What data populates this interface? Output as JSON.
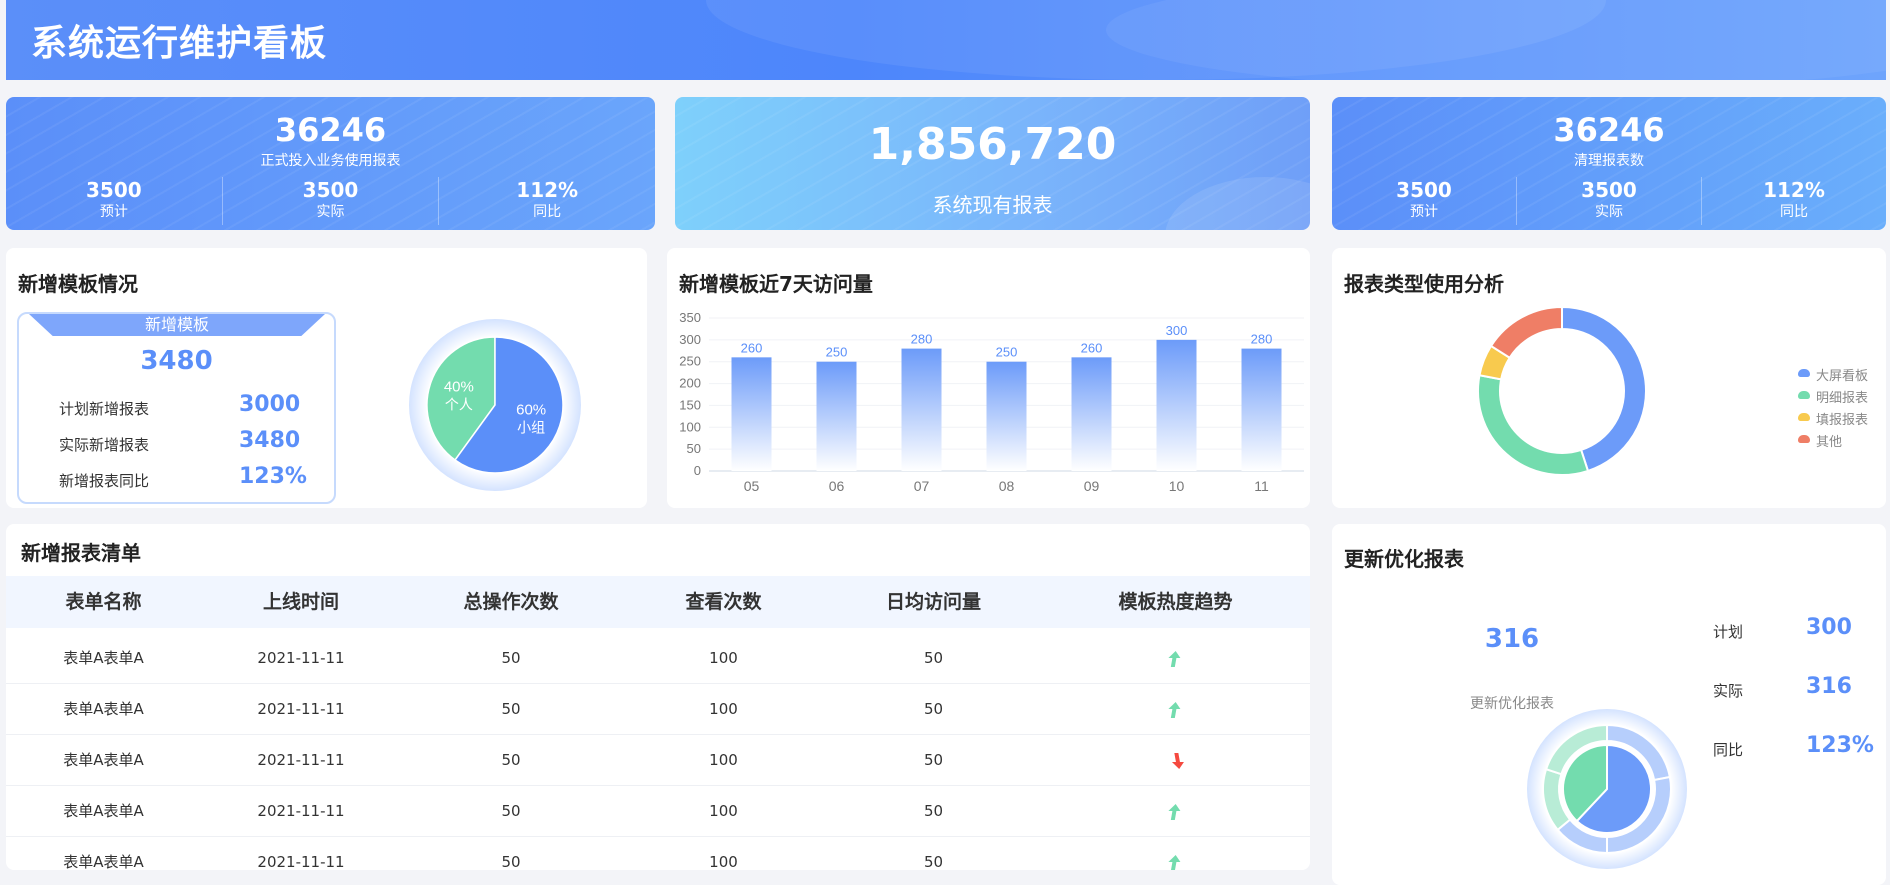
{
  "header": {
    "title": "系统运行维护看板"
  },
  "kpi_left": {
    "value": "36246",
    "label": "正式投入业务使用报表",
    "subs": [
      {
        "value": "3500",
        "label": "预计"
      },
      {
        "value": "3500",
        "label": "实际"
      },
      {
        "value": "112%",
        "label": "同比"
      }
    ]
  },
  "kpi_mid": {
    "value": "1,856,720",
    "label": "系统现有报表"
  },
  "kpi_right": {
    "value": "36246",
    "label": "清理报表数",
    "subs": [
      {
        "value": "3500",
        "label": "预计"
      },
      {
        "value": "3500",
        "label": "实际"
      },
      {
        "value": "112%",
        "label": "同比"
      }
    ]
  },
  "template_card": {
    "title": "新增模板情况",
    "tab_label": "新增模板",
    "total": "3480",
    "rows": [
      {
        "label": "计划新增报表",
        "value": "3000"
      },
      {
        "label": "实际新增报表",
        "value": "3480"
      },
      {
        "label": "新增报表同比",
        "value": "123%"
      }
    ]
  },
  "visits_card": {
    "title": "新增模板近7天访问量"
  },
  "types_card": {
    "title": "报表类型使用分析"
  },
  "list_card": {
    "title": "新增报表清单",
    "columns": [
      "表单名称",
      "上线时间",
      "总操作次数",
      "查看次数",
      "日均访问量",
      "模板热度趋势"
    ],
    "rows": [
      {
        "name": "表单A表单A",
        "date": "2021-11-11",
        "ops": "50",
        "views": "100",
        "daily": "50",
        "trend": "up"
      },
      {
        "name": "表单A表单A",
        "date": "2021-11-11",
        "ops": "50",
        "views": "100",
        "daily": "50",
        "trend": "up"
      },
      {
        "name": "表单A表单A",
        "date": "2021-11-11",
        "ops": "50",
        "views": "100",
        "daily": "50",
        "trend": "down"
      },
      {
        "name": "表单A表单A",
        "date": "2021-11-11",
        "ops": "50",
        "views": "100",
        "daily": "50",
        "trend": "up"
      },
      {
        "name": "表单A表单A",
        "date": "2021-11-11",
        "ops": "50",
        "views": "100",
        "daily": "50",
        "trend": "up"
      }
    ],
    "trend_colors": {
      "up": "#73dcae",
      "down": "#f5493f"
    }
  },
  "opt_card": {
    "title": "更新优化报表",
    "center_value": "316",
    "center_label": "更新优化报表",
    "stats": [
      {
        "label": "计划",
        "value": "300"
      },
      {
        "label": "实际",
        "value": "316"
      },
      {
        "label": "同比",
        "value": "123%"
      }
    ]
  },
  "chart_data": [
    {
      "type": "pie",
      "labels": [
        "个人",
        "小组"
      ],
      "values": [
        40,
        60
      ],
      "value_labels": [
        "40%",
        "60%"
      ],
      "colors": [
        "#73dcae",
        "#5b8ff9"
      ]
    },
    {
      "type": "bar",
      "categories": [
        "05",
        "06",
        "07",
        "08",
        "09",
        "10",
        "11"
      ],
      "values": [
        260,
        250,
        280,
        250,
        260,
        300,
        280
      ],
      "ylim": [
        0,
        350
      ],
      "yticks": [
        0,
        50,
        100,
        150,
        200,
        250,
        300,
        350
      ],
      "grid": true,
      "color": "#6c9bf9"
    },
    {
      "type": "pie",
      "donut": true,
      "series": [
        {
          "name": "大屏看板",
          "value": 45,
          "color": "#6c9bf9"
        },
        {
          "name": "明细报表",
          "value": 33,
          "color": "#73dcae"
        },
        {
          "name": "填报报表",
          "value": 6,
          "color": "#f8ca4e"
        },
        {
          "name": "其他",
          "value": 16,
          "color": "#ef7e66"
        }
      ],
      "legend": "right"
    },
    {
      "type": "pie",
      "nested": true,
      "inner": [
        {
          "value": 62,
          "color": "#6c9bf9"
        },
        {
          "value": 38,
          "color": "#73dcae"
        }
      ],
      "outer": [
        {
          "value": 22,
          "color": "#b6cefc"
        },
        {
          "value": 28,
          "color": "#b6cefc"
        },
        {
          "value": 14,
          "color": "#b6cefc"
        },
        {
          "value": 16,
          "color": "#b8ecd6"
        },
        {
          "value": 20,
          "color": "#b8ecd6"
        }
      ]
    }
  ]
}
